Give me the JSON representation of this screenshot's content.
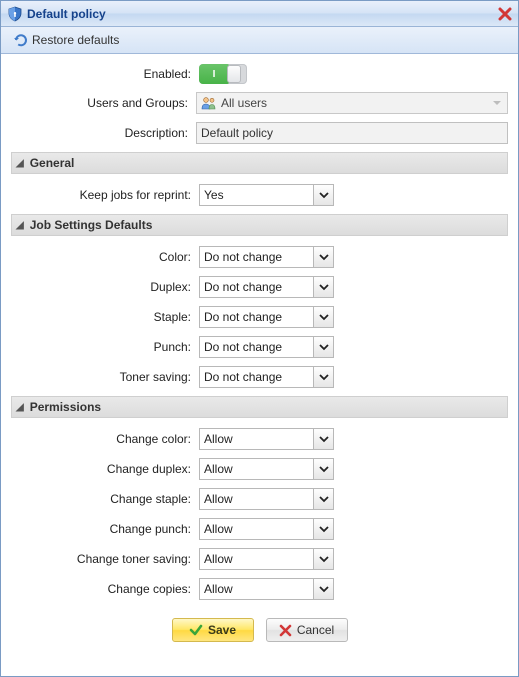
{
  "titlebar": {
    "title": "Default policy"
  },
  "toolbar": {
    "restore_defaults": "Restore defaults"
  },
  "form": {
    "enabled_label": "Enabled:",
    "toggle_on_text": "I",
    "users_groups_label": "Users and Groups:",
    "users_groups_value": "All users",
    "description_label": "Description:",
    "description_value": "Default policy"
  },
  "sections": {
    "general": {
      "title": "General",
      "keep_jobs_label": "Keep jobs for reprint:",
      "keep_jobs_value": "Yes"
    },
    "job_defaults": {
      "title": "Job Settings Defaults",
      "color_label": "Color:",
      "color_value": "Do not change",
      "duplex_label": "Duplex:",
      "duplex_value": "Do not change",
      "staple_label": "Staple:",
      "staple_value": "Do not change",
      "punch_label": "Punch:",
      "punch_value": "Do not change",
      "toner_label": "Toner saving:",
      "toner_value": "Do not change"
    },
    "permissions": {
      "title": "Permissions",
      "change_color_label": "Change color:",
      "change_color_value": "Allow",
      "change_duplex_label": "Change duplex:",
      "change_duplex_value": "Allow",
      "change_staple_label": "Change staple:",
      "change_staple_value": "Allow",
      "change_punch_label": "Change punch:",
      "change_punch_value": "Allow",
      "change_toner_label": "Change toner saving:",
      "change_toner_value": "Allow",
      "change_copies_label": "Change copies:",
      "change_copies_value": "Allow"
    }
  },
  "buttons": {
    "save": "Save",
    "cancel": "Cancel"
  }
}
